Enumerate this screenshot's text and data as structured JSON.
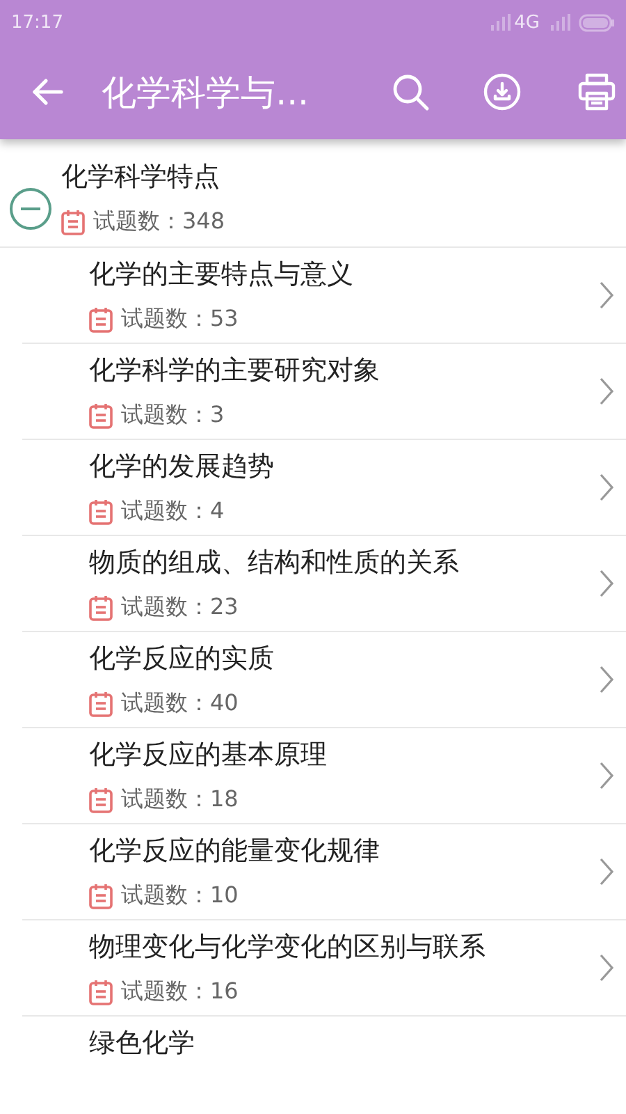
{
  "status_bar": {
    "time": "17:17",
    "network": "4G"
  },
  "toolbar": {
    "title": "化学科学与..."
  },
  "chapter": {
    "title": "化学科学特点",
    "count_label": "试题数：348",
    "expanded": true,
    "children": [
      {
        "title": "化学的主要特点与意义",
        "count_label": "试题数：53"
      },
      {
        "title": "化学科学的主要研究对象",
        "count_label": "试题数：3"
      },
      {
        "title": "化学的发展趋势",
        "count_label": "试题数：4"
      },
      {
        "title": "物质的组成、结构和性质的关系",
        "count_label": "试题数：23"
      },
      {
        "title": "化学反应的实质",
        "count_label": "试题数：40"
      },
      {
        "title": "化学反应的基本原理",
        "count_label": "试题数：18"
      },
      {
        "title": "化学反应的能量变化规律",
        "count_label": "试题数：10"
      },
      {
        "title": "物理变化与化学变化的区别与联系",
        "count_label": "试题数：16"
      },
      {
        "title": "绿色化学"
      }
    ]
  }
}
